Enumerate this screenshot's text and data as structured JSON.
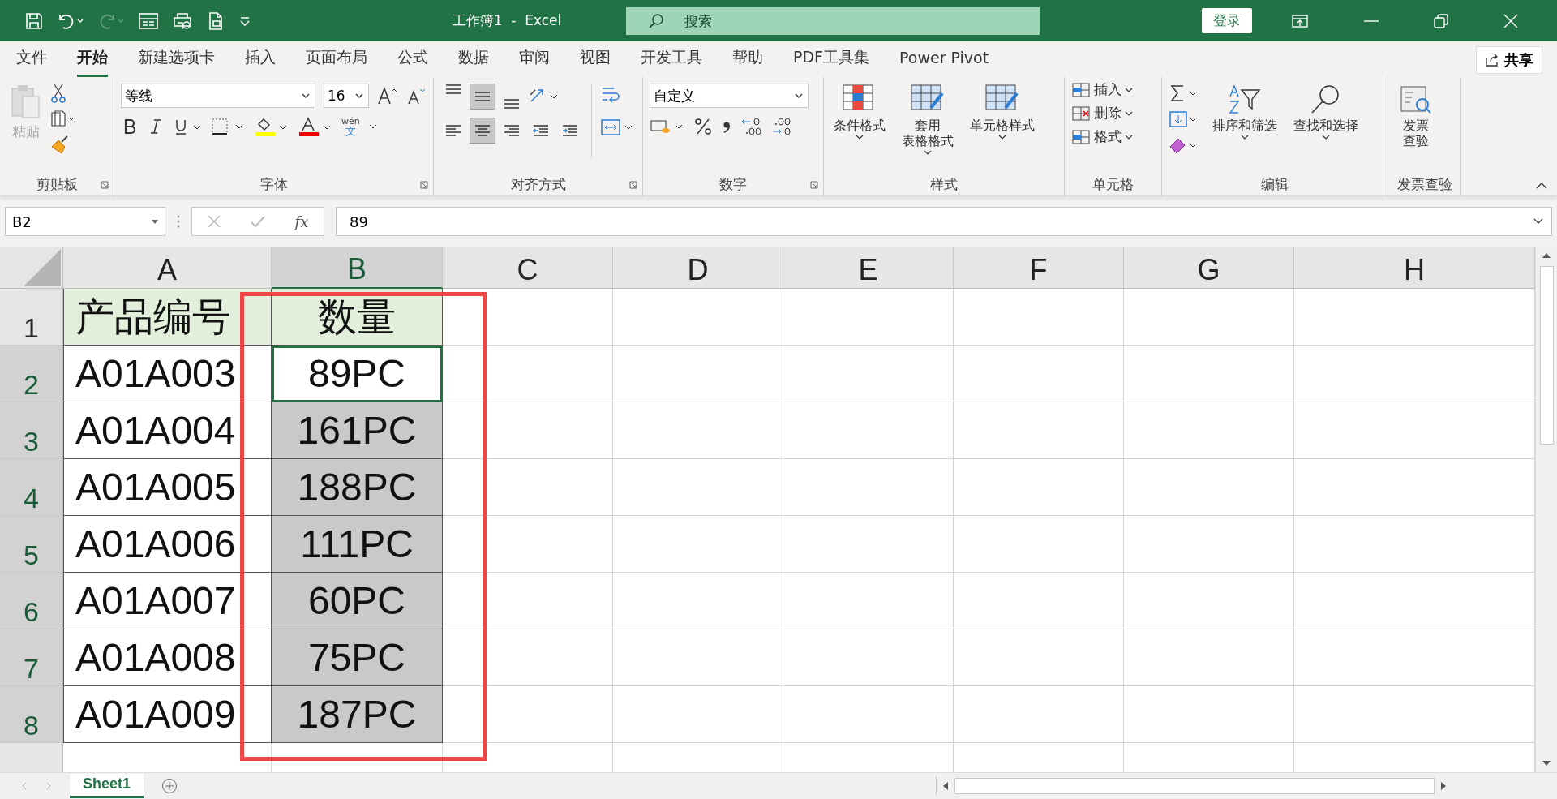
{
  "title_bar": {
    "title": "工作簿1  -  Excel",
    "search": {
      "placeholder": "搜索"
    },
    "login": "登录"
  },
  "menu_tabs": [
    {
      "label": "文件",
      "selected": false
    },
    {
      "label": "开始",
      "selected": true
    },
    {
      "label": "新建选项卡",
      "selected": false
    },
    {
      "label": "插入",
      "selected": false
    },
    {
      "label": "页面布局",
      "selected": false
    },
    {
      "label": "公式",
      "selected": false
    },
    {
      "label": "数据",
      "selected": false
    },
    {
      "label": "审阅",
      "selected": false
    },
    {
      "label": "视图",
      "selected": false
    },
    {
      "label": "开发工具",
      "selected": false
    },
    {
      "label": "帮助",
      "selected": false
    },
    {
      "label": "PDF工具集",
      "selected": false
    },
    {
      "label": "Power Pivot",
      "selected": false
    }
  ],
  "share": "共享",
  "ribbon": {
    "clipboard": {
      "paste": "粘贴",
      "label": "剪贴板"
    },
    "font": {
      "font_name": "等线",
      "font_size": "16",
      "phonetic_top": "wén",
      "phonetic_bottom": "文",
      "label": "字体"
    },
    "alignment": {
      "top_row": [
        {
          "selected": false
        },
        {
          "selected": true
        },
        {
          "selected": false
        }
      ],
      "bottom_row": [
        {
          "selected": false
        },
        {
          "selected": true
        },
        {
          "selected": false
        },
        {
          "selected": false
        },
        {
          "selected": false
        }
      ],
      "label": "对齐方式"
    },
    "number": {
      "format": "自定义",
      "label": "数字"
    },
    "styles": {
      "buttons": [
        {
          "lines": [
            "条件格式"
          ]
        },
        {
          "lines": [
            "套用",
            "表格格式"
          ]
        },
        {
          "lines": [
            "单元格样式"
          ]
        }
      ],
      "label": "样式"
    },
    "cells": {
      "buttons": [
        "插入",
        "删除",
        "格式"
      ],
      "label": "单元格"
    },
    "editing": {
      "buttons": [
        "排序和筛选",
        "查找和选择"
      ],
      "label": "编辑"
    },
    "invoice": {
      "lines": [
        "发票",
        "查验"
      ],
      "label": "发票查验"
    }
  },
  "formula_bar": {
    "name_box": "B2",
    "fx": "fx",
    "formula": "89"
  },
  "columns": [
    {
      "label": "A",
      "selected": false
    },
    {
      "label": "B",
      "selected": true
    },
    {
      "label": "C",
      "selected": false
    },
    {
      "label": "D",
      "selected": false
    },
    {
      "label": "E",
      "selected": false
    },
    {
      "label": "F",
      "selected": false
    },
    {
      "label": "G",
      "selected": false
    },
    {
      "label": "H",
      "selected": false
    }
  ],
  "rows": [
    {
      "number": "1",
      "selected": false,
      "cells": [
        {
          "text": "产品编号",
          "kind": "header",
          "active": false
        },
        {
          "text": "数量",
          "kind": "header",
          "active": false
        }
      ]
    },
    {
      "number": "2",
      "selected": true,
      "cells": [
        {
          "text": "A01A003",
          "kind": "plain",
          "active": false
        },
        {
          "text": "89PC",
          "kind": "plain",
          "active": true
        }
      ]
    },
    {
      "number": "3",
      "selected": true,
      "cells": [
        {
          "text": "A01A004",
          "kind": "plain",
          "active": false
        },
        {
          "text": "161PC",
          "kind": "shaded",
          "active": false
        }
      ]
    },
    {
      "number": "4",
      "selected": true,
      "cells": [
        {
          "text": "A01A005",
          "kind": "plain",
          "active": false
        },
        {
          "text": "188PC",
          "kind": "shaded",
          "active": false
        }
      ]
    },
    {
      "number": "5",
      "selected": true,
      "cells": [
        {
          "text": "A01A006",
          "kind": "plain",
          "active": false
        },
        {
          "text": "111PC",
          "kind": "shaded",
          "active": false
        }
      ]
    },
    {
      "number": "6",
      "selected": true,
      "cells": [
        {
          "text": "A01A007",
          "kind": "plain",
          "active": false
        },
        {
          "text": "60PC",
          "kind": "shaded",
          "active": false
        }
      ]
    },
    {
      "number": "7",
      "selected": true,
      "cells": [
        {
          "text": "A01A008",
          "kind": "plain",
          "active": false
        },
        {
          "text": "75PC",
          "kind": "shaded",
          "active": false
        }
      ]
    },
    {
      "number": "8",
      "selected": true,
      "cells": [
        {
          "text": "A01A009",
          "kind": "plain",
          "active": false
        },
        {
          "text": "187PC",
          "kind": "shaded",
          "active": false
        }
      ]
    }
  ],
  "sheet_tabs": [
    {
      "label": "Sheet1",
      "selected": true
    }
  ]
}
